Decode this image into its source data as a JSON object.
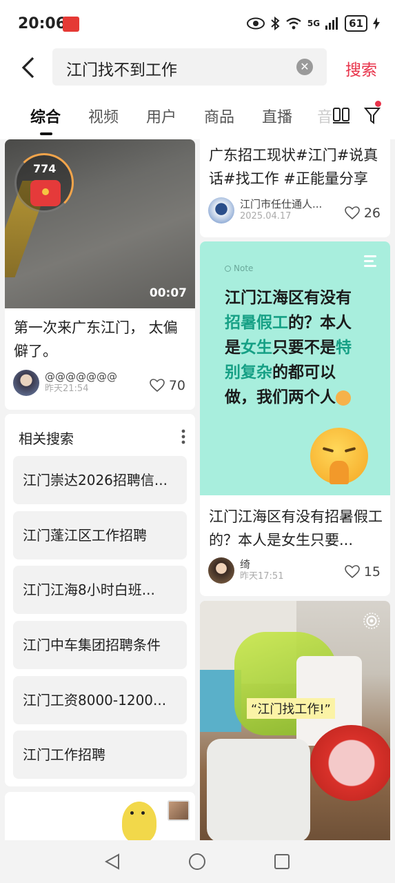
{
  "status": {
    "time": "20:06",
    "network": "5G",
    "battery": "61"
  },
  "search": {
    "query": "江门找不到工作",
    "button": "搜索"
  },
  "tabs": [
    "综合",
    "视频",
    "用户",
    "商品",
    "直播",
    "音"
  ],
  "cards": {
    "left_video": {
      "counter": "774",
      "duration": "00:07",
      "title": "第一次来广东江门， 太偏僻了。",
      "author": "@@@@@@@",
      "date": "昨天21:54",
      "likes": "70"
    },
    "right_top": {
      "title": "广东招工现状#江门#说真话#找工作 #正能量分享",
      "author": "江门市任仕通人...",
      "date": "2025.04.17",
      "likes": "26"
    },
    "note": {
      "tag": "Note",
      "heading_lines": [
        [
          "江门江海区有没有"
        ],
        [
          "招暑假工",
          "的？本人"
        ],
        [
          "是",
          "女生",
          "只要不是",
          "特"
        ],
        [
          "别复杂",
          "的都可以"
        ],
        [
          "做，我们两个人"
        ]
      ],
      "title": "江门江海区有没有招暑假工的？本人是女生只要...",
      "author": "绮",
      "date": "昨天17:51",
      "likes": "15"
    },
    "photo": {
      "caption": "“江门找工作!”"
    }
  },
  "related": {
    "title": "相关搜索",
    "items": [
      "江门崇达2026招聘信...",
      "江门蓬江区工作招聘",
      "江门江海8小时白班...",
      "江门中车集团招聘条件",
      "江门工资8000-1200...",
      "江门工作招聘"
    ]
  },
  "colors": {
    "accent": "#e8334a",
    "note_bg": "#a8eedd",
    "highlight": "#16a085"
  }
}
